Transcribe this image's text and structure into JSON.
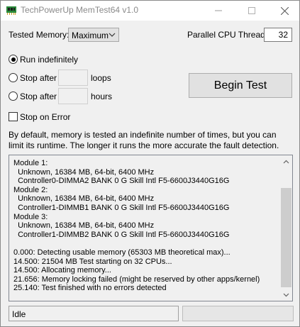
{
  "window": {
    "title": "TechPowerUp MemTest64 v1.0"
  },
  "settings": {
    "tested_memory_label": "Tested Memory:",
    "tested_memory_value": "Maximum",
    "threads_label": "Parallel CPU Threads:",
    "threads_value": "32"
  },
  "modes": {
    "run_indefinitely": "Run indefinitely",
    "stop_after": "Stop after",
    "loops": "loops",
    "hours": "hours",
    "loops_value": "",
    "hours_value": "",
    "selected": "run_indefinitely",
    "stop_on_error": "Stop on Error",
    "stop_on_error_checked": false
  },
  "begin_button": "Begin Test",
  "description": "By default, memory is tested an indefinite number of times, but you can limit its runtime. The longer it runs the more accurate the fault detection.",
  "log": {
    "lines": [
      "Module 1:",
      "  Unknown, 16384 MB, 64-bit, 6400 MHz",
      "  Controller0-DIMMA2 BANK 0 G Skill Intl F5-6600J3440G16G",
      "Module 2:",
      "  Unknown, 16384 MB, 64-bit, 6400 MHz",
      "  Controller1-DIMMB1 BANK 0 G Skill Intl F5-6600J3440G16G",
      "Module 3:",
      "  Unknown, 16384 MB, 64-bit, 6400 MHz",
      "  Controller1-DIMMB2 BANK 0 G Skill Intl F5-6600J3440G16G",
      "",
      "0.000: Detecting usable memory (65303 MB theoretical max)...",
      "14.500: 21504 MB Test starting on 32 CPUs...",
      "14.500: Allocating memory...",
      "21.656: Memory locking failed (might be reserved by other apps/kernel)",
      "25.140: Test finished with no errors detected"
    ]
  },
  "status": {
    "text": "Idle",
    "progress": 0
  },
  "colors": {
    "progress_fill": "#06b025"
  },
  "icons": {
    "app": "memory-chip-icon",
    "minimize": "minimize-icon",
    "maximize": "maximize-icon",
    "close": "close-icon",
    "dropdown": "chevron-down-icon",
    "scroll_up": "scroll-up-arrow-icon",
    "scroll_down": "scroll-down-arrow-icon"
  }
}
